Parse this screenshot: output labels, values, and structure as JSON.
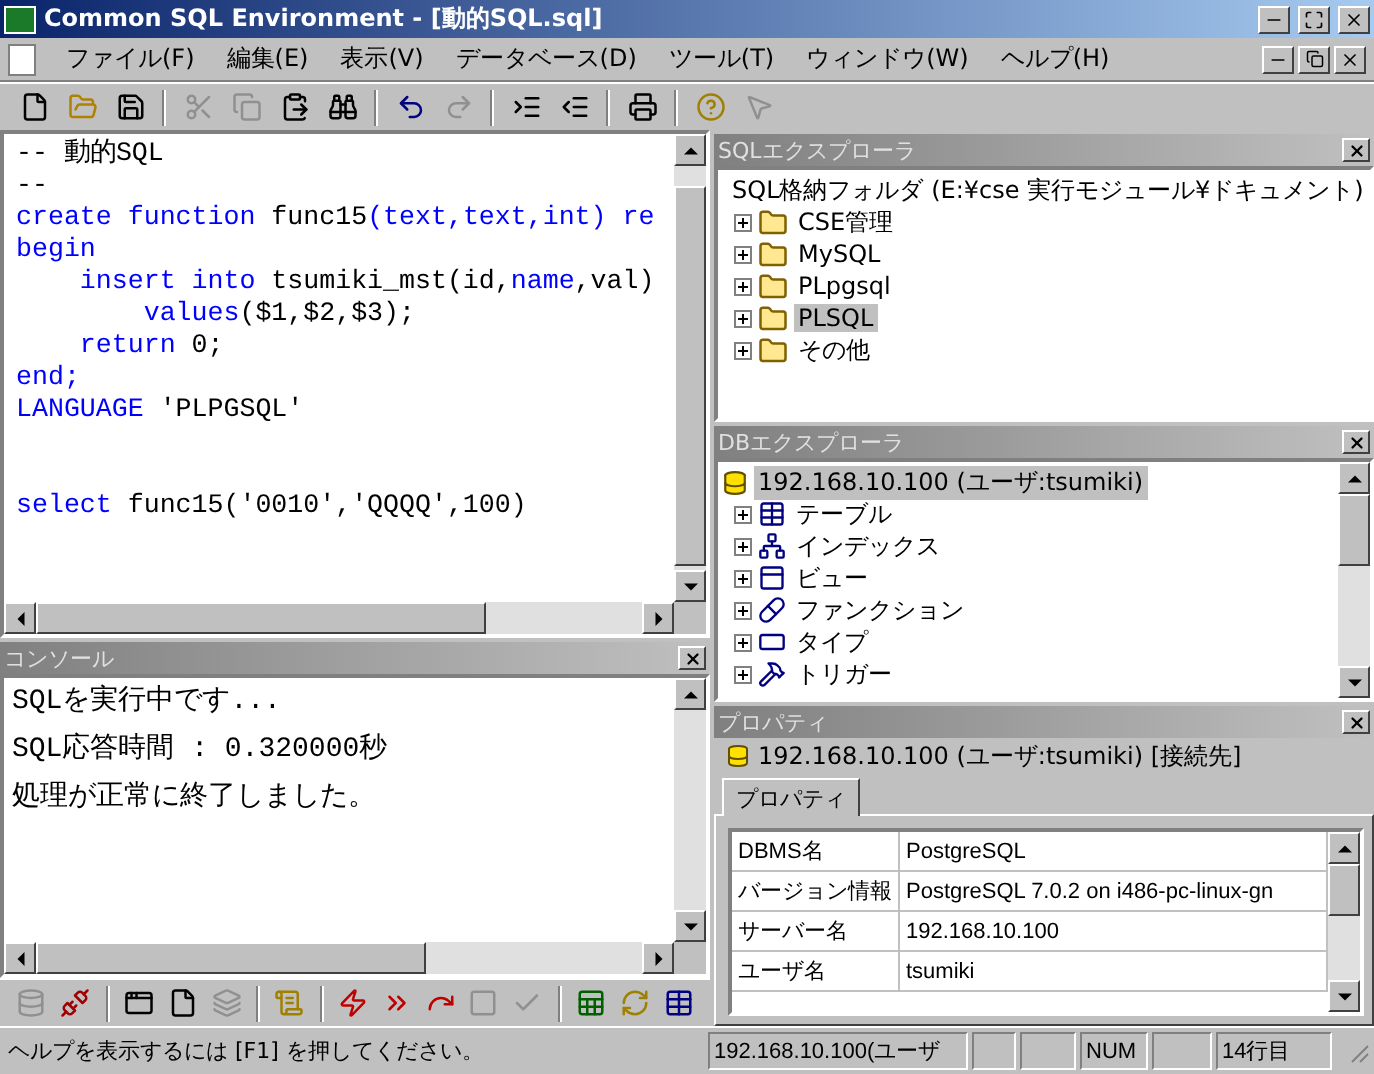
{
  "window": {
    "title": "Common SQL Environment - [動的SQL.sql]"
  },
  "menu": [
    "ファイル(F)",
    "編集(E)",
    "表示(V)",
    "データベース(D)",
    "ツール(T)",
    "ウィンドウ(W)",
    "ヘルプ(H)"
  ],
  "toolbar": [
    {
      "kind": "new",
      "disabled": false
    },
    {
      "kind": "open",
      "disabled": false
    },
    {
      "kind": "save",
      "disabled": false
    },
    {
      "kind": "sep"
    },
    {
      "kind": "cut",
      "disabled": true
    },
    {
      "kind": "copy",
      "disabled": true
    },
    {
      "kind": "paste",
      "disabled": false
    },
    {
      "kind": "find",
      "disabled": false
    },
    {
      "kind": "sep"
    },
    {
      "kind": "undo",
      "disabled": false
    },
    {
      "kind": "redo",
      "disabled": true
    },
    {
      "kind": "sep"
    },
    {
      "kind": "indent",
      "disabled": false
    },
    {
      "kind": "outdent",
      "disabled": false
    },
    {
      "kind": "sep"
    },
    {
      "kind": "print",
      "disabled": false
    },
    {
      "kind": "sep"
    },
    {
      "kind": "help",
      "disabled": false
    },
    {
      "kind": "pointer",
      "disabled": true
    }
  ],
  "editor": {
    "lines": [
      [
        {
          "text": "-- 動的SQL",
          "kind": "plain"
        }
      ],
      [
        {
          "text": "--",
          "kind": "plain"
        }
      ],
      [
        {
          "text": "create function ",
          "kind": "keyword"
        },
        {
          "text": "func15",
          "kind": "plain"
        },
        {
          "text": "(text,text,int) re",
          "kind": "keyword"
        }
      ],
      [
        {
          "text": "begin",
          "kind": "keyword"
        }
      ],
      [
        {
          "text": "    insert into ",
          "kind": "keyword"
        },
        {
          "text": "tsumiki_mst(id,",
          "kind": "plain"
        },
        {
          "text": "name",
          "kind": "keyword"
        },
        {
          "text": ",val)",
          "kind": "plain"
        }
      ],
      [
        {
          "text": "        values",
          "kind": "keyword"
        },
        {
          "text": "($1,$2,$3);",
          "kind": "plain"
        }
      ],
      [
        {
          "text": "    return ",
          "kind": "keyword"
        },
        {
          "text": "0;",
          "kind": "plain"
        }
      ],
      [
        {
          "text": "end;",
          "kind": "keyword"
        }
      ],
      [
        {
          "text": "LANGUAGE ",
          "kind": "keyword"
        },
        {
          "text": "'PLPGSQL'",
          "kind": "plain"
        }
      ],
      {
        "kind": "blank"
      },
      {
        "kind": "blank"
      },
      [
        {
          "text": "select ",
          "kind": "keyword"
        },
        {
          "text": "func15('0010','QQQQ',100)",
          "kind": "plain"
        }
      ]
    ]
  },
  "console": {
    "title": "コンソール",
    "lines": [
      "SQLを実行中です...",
      "SQL応答時間 : 0.320000秒",
      "処理が正常に終了しました。"
    ]
  },
  "bottom_toolbar": [
    {
      "kind": "connect",
      "disabled": true
    },
    {
      "kind": "disconnect",
      "disabled": false
    },
    {
      "kind": "sep"
    },
    {
      "kind": "window",
      "disabled": false
    },
    {
      "kind": "new",
      "disabled": false
    },
    {
      "kind": "cascade",
      "disabled": true
    },
    {
      "kind": "sep"
    },
    {
      "kind": "script",
      "disabled": false
    },
    {
      "kind": "sep"
    },
    {
      "kind": "run",
      "disabled": false
    },
    {
      "kind": "runall",
      "disabled": false
    },
    {
      "kind": "step",
      "disabled": false
    },
    {
      "kind": "stop",
      "disabled": true
    },
    {
      "kind": "check",
      "disabled": true
    },
    {
      "kind": "sep"
    },
    {
      "kind": "import",
      "disabled": false
    },
    {
      "kind": "refresh",
      "disabled": false
    },
    {
      "kind": "export",
      "disabled": false
    }
  ],
  "sql_explorer": {
    "title": "SQLエクスプローラ",
    "root": "SQL格納フォルダ (E:¥cse 実行モジュール¥ドキュメント)",
    "items": [
      {
        "label": "CSE管理",
        "selected": false
      },
      {
        "label": "MySQL",
        "selected": false
      },
      {
        "label": "PLpgsql",
        "selected": false
      },
      {
        "label": "PLSQL",
        "selected": true
      },
      {
        "label": "その他",
        "selected": false
      }
    ]
  },
  "db_explorer": {
    "title": "DBエクスプローラ",
    "root": {
      "label": "192.168.10.100 (ユーザ:tsumiki)",
      "selected": true
    },
    "items": [
      {
        "label": "テーブル",
        "kind": "table"
      },
      {
        "label": "インデックス",
        "kind": "index"
      },
      {
        "label": "ビュー",
        "kind": "view"
      },
      {
        "label": "ファンクション",
        "kind": "function"
      },
      {
        "label": "タイプ",
        "kind": "type"
      },
      {
        "label": "トリガー",
        "kind": "trigger"
      }
    ]
  },
  "properties": {
    "title": "プロパティ",
    "connection": "192.168.10.100 (ユーザ:tsumiki) [接続先]",
    "tabs": [
      {
        "label": "プロパティ",
        "selected": true
      }
    ],
    "rows": [
      {
        "name": "DBMS名",
        "value": "PostgreSQL"
      },
      {
        "name": "バージョン情報",
        "value": "PostgreSQL 7.0.2 on i486-pc-linux-gn"
      },
      {
        "name": "サーバー名",
        "value": "192.168.10.100"
      },
      {
        "name": "ユーザ名",
        "value": "tsumiki"
      }
    ]
  },
  "status_bar": {
    "message": "ヘルプを表示するには [F1] を押してください。",
    "panes": [
      {
        "kind": "text",
        "text": "192.168.10.100(ユーザ"
      },
      {
        "kind": "empty"
      },
      {
        "kind": "empty"
      },
      {
        "kind": "text",
        "text": "NUM"
      },
      {
        "kind": "empty"
      },
      {
        "kind": "text",
        "text": "14行目"
      }
    ]
  }
}
